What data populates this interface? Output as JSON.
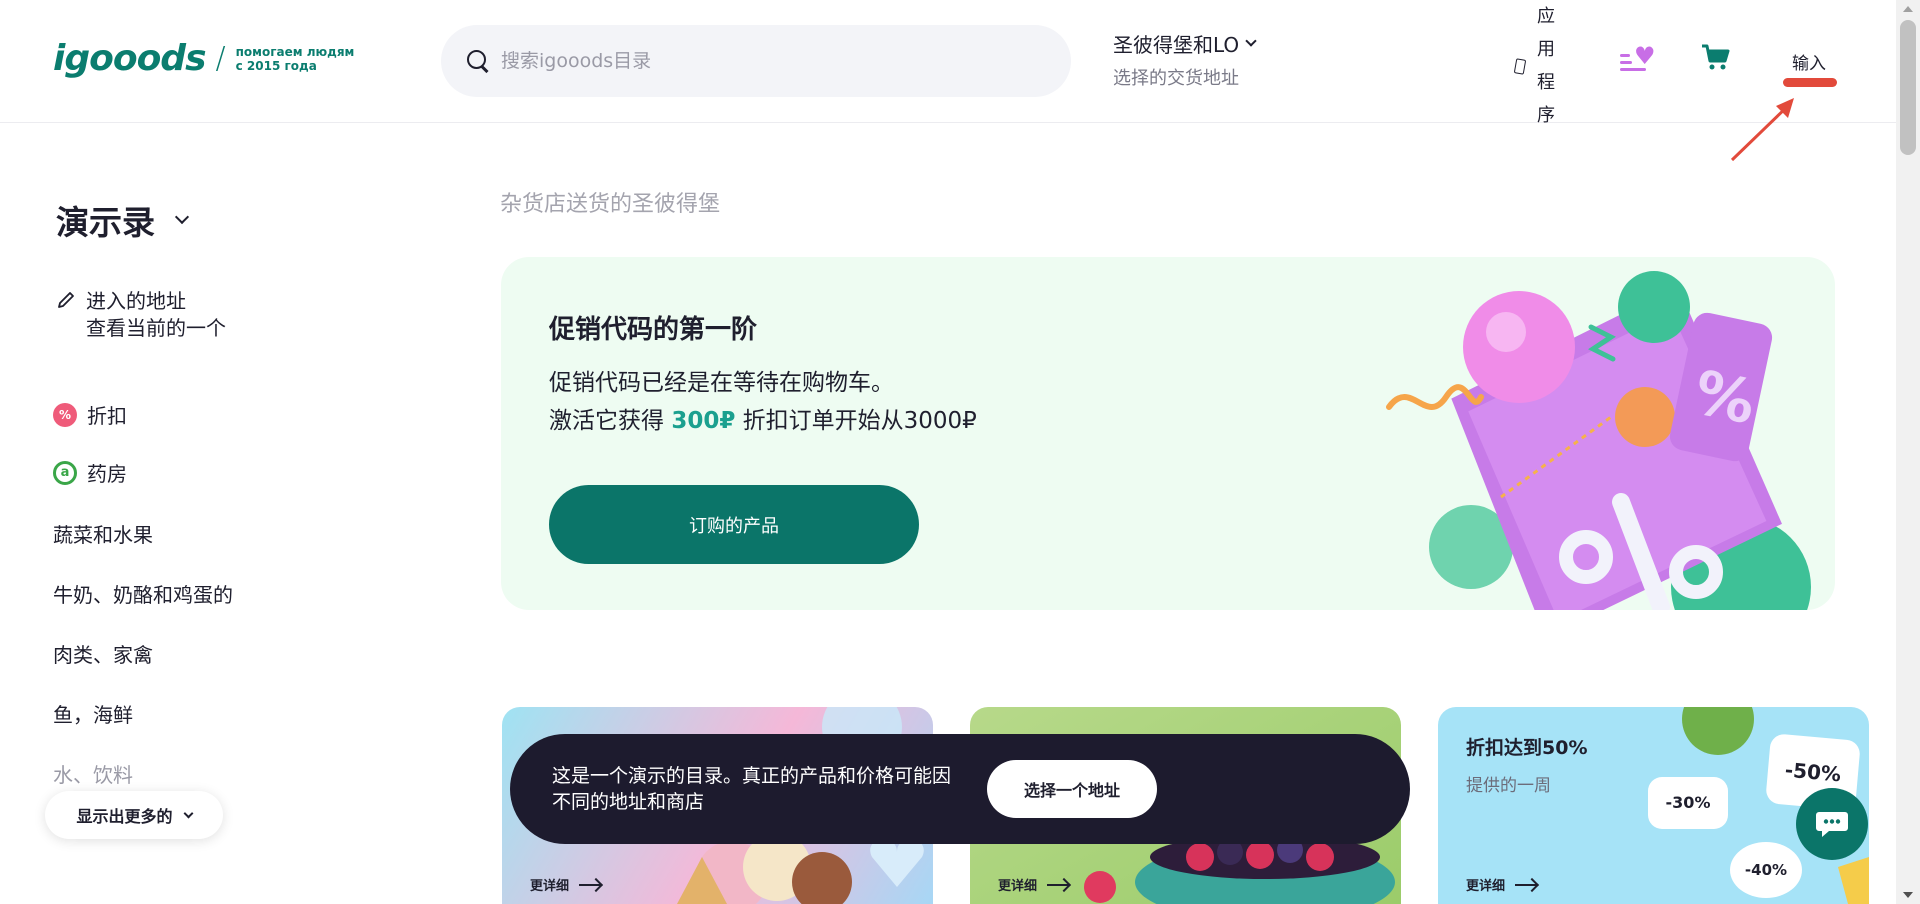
{
  "header": {
    "logo": "igooods",
    "logo_tagline_1": "помогаем людям",
    "logo_tagline_2": "с 2015 года",
    "search_placeholder": "搜索igooods目录",
    "city": "圣彼得堡和LO",
    "city_sub": "选择的交货地址",
    "app_label": "应用程序",
    "login_label": "输入",
    "icons": {
      "search": "search-icon",
      "phone": "phone-icon",
      "favorites": "favorites-icon",
      "cart": "cart-icon"
    },
    "colors": {
      "brand": "#0b7d6f",
      "accent_purple": "#c86ee6",
      "annotation": "#e24a3b"
    }
  },
  "sidebar": {
    "title": "演示录",
    "address_line1": "进入的地址",
    "address_line2": "查看当前的一个",
    "items": [
      {
        "label": "折扣",
        "badge": "%"
      },
      {
        "label": "药房",
        "badge": "a"
      },
      {
        "label": "蔬菜和水果"
      },
      {
        "label": "牛奶、奶酪和鸡蛋的"
      },
      {
        "label": "肉类、家禽"
      },
      {
        "label": "鱼，海鲜"
      },
      {
        "label": "水、饮料"
      }
    ],
    "show_more": "显示出更多的"
  },
  "main": {
    "breadcrumb": "杂货店送货的圣彼得堡",
    "promo": {
      "title": "促销代码的第一阶",
      "line1": "促销代码已经是在等待在购物车。",
      "line2_pre": "激活它获得 ",
      "line2_amount": "300₽",
      "line2_post": " 折扣订单开始从3000₽",
      "button": "订购的产品",
      "bg_color": "#eefcf2",
      "button_color": "#0b7569"
    },
    "cards": [
      {
        "more": "更详细"
      },
      {
        "more": "更详细"
      },
      {
        "title": "折扣达到50%",
        "subtitle": "提供的一周",
        "more": "更详细",
        "tags": [
          "-30%",
          "-50%",
          "-40%"
        ]
      }
    ]
  },
  "toast": {
    "text": "这是一个演示的目录。真正的产品和价格可能因不同的地址和商店",
    "button": "选择一个地址"
  }
}
